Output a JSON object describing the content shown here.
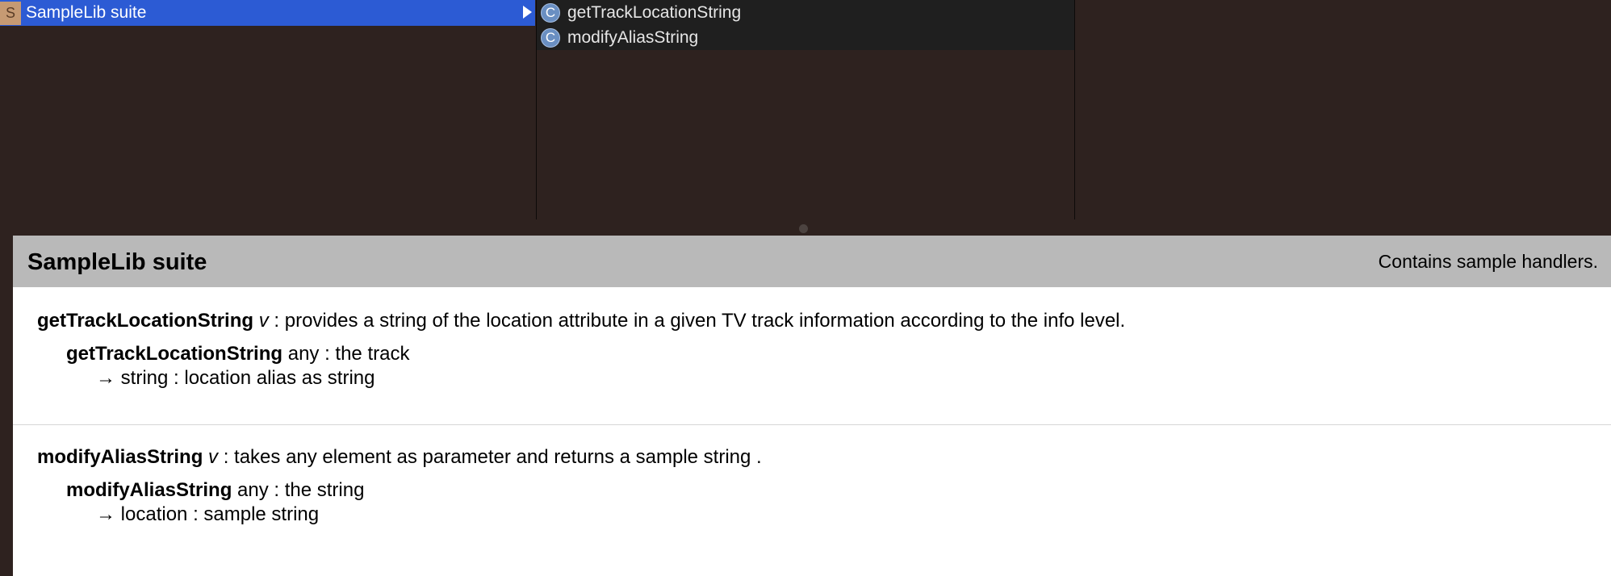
{
  "browser": {
    "suites": [
      {
        "icon_letter": "S",
        "label": "SampleLib suite",
        "selected": true
      }
    ],
    "commands": [
      {
        "icon_letter": "C",
        "label": "getTrackLocationString"
      },
      {
        "icon_letter": "C",
        "label": "modifyAliasString"
      }
    ]
  },
  "detail": {
    "suite_title": "SampleLib suite",
    "suite_description": "Contains sample handlers.",
    "commands": [
      {
        "name": "getTrackLocationString",
        "kind": "v",
        "summary": ": provides a string of the location attribute in a given TV track information according to the info level.",
        "param_name": "getTrackLocationString",
        "param_desc": "any : the track",
        "result_arrow": "→",
        "result_desc": "string : location alias as string"
      },
      {
        "name": "modifyAliasString",
        "kind": "v",
        "summary": ": takes any element as parameter and returns a sample string .",
        "param_name": "modifyAliasString",
        "param_desc": "any : the string",
        "result_arrow": "→",
        "result_desc": "location : sample string"
      }
    ]
  },
  "colors": {
    "background": "#2e221f",
    "selection": "#2c5bd4",
    "suite_icon": "#c69a73",
    "command_icon": "#6a8fc2",
    "header_band": "#b9b9b9"
  }
}
